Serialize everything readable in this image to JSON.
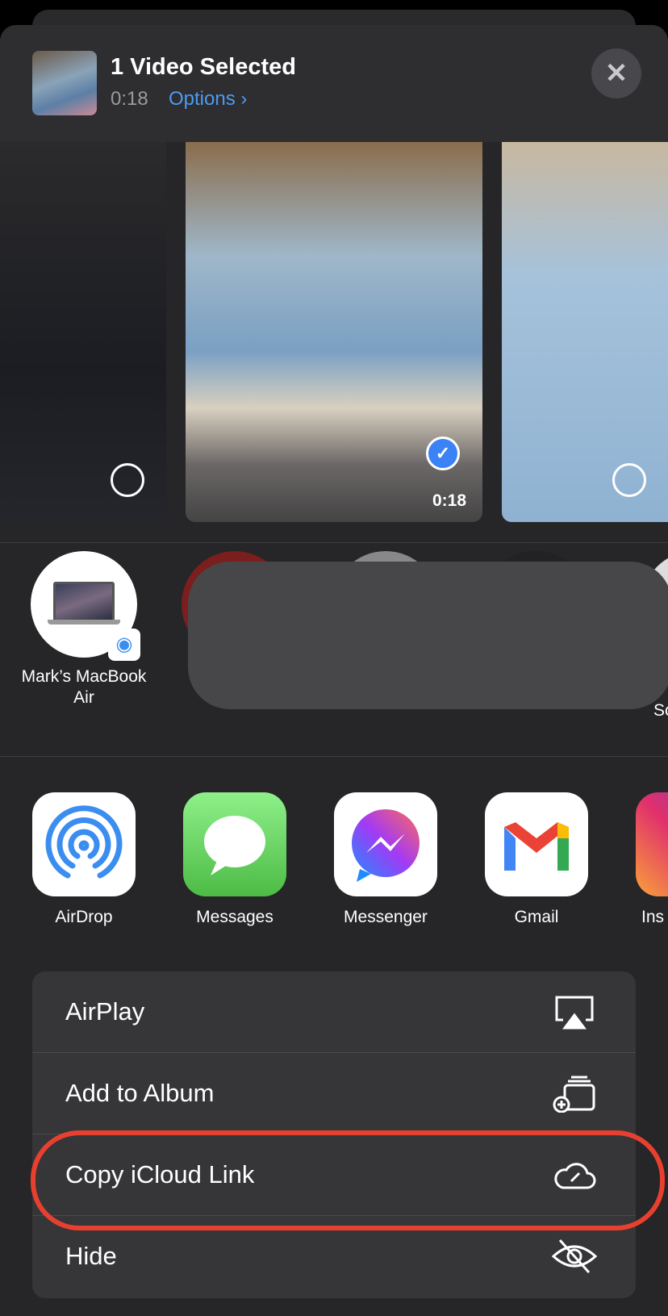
{
  "header": {
    "title": "1 Video Selected",
    "duration": "0:18",
    "options_label": "Options",
    "close_icon": "x-icon"
  },
  "photos": [
    {
      "selected": false
    },
    {
      "selected": true,
      "duration": "0:18"
    },
    {
      "selected": false
    }
  ],
  "people": {
    "device_name": "Mark’s MacBook Air",
    "badge_icon": "airdrop-icon",
    "partial_label": "Sc"
  },
  "apps": [
    {
      "label": "AirDrop"
    },
    {
      "label": "Messages"
    },
    {
      "label": "Messenger"
    },
    {
      "label": "Gmail"
    },
    {
      "label": "Ins"
    }
  ],
  "actions": [
    {
      "label": "AirPlay",
      "icon": "airplay-icon"
    },
    {
      "label": "Add to Album",
      "icon": "add-to-album-icon"
    },
    {
      "label": "Copy iCloud Link",
      "icon": "icloud-link-icon",
      "highlighted": true
    },
    {
      "label": "Hide",
      "icon": "eye-slash-icon"
    }
  ],
  "colors": {
    "accent": "#4a9cf3",
    "highlight": "#e8402f",
    "check": "#3b82f6"
  }
}
